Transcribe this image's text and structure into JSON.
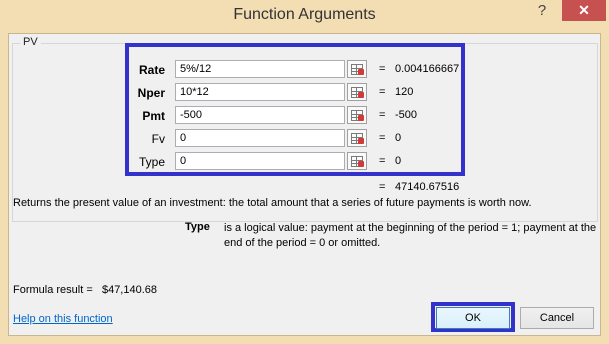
{
  "window": {
    "title": "Function Arguments",
    "help_glyph": "?",
    "close_glyph": "✕"
  },
  "function": {
    "name": "PV",
    "arguments": [
      {
        "label": "Rate",
        "value": "5%/12",
        "result": "0.004166667",
        "bold": true
      },
      {
        "label": "Nper",
        "value": "10*12",
        "result": "120",
        "bold": true
      },
      {
        "label": "Pmt",
        "value": "-500",
        "result": "-500",
        "bold": true
      },
      {
        "label": "Fv",
        "value": "0",
        "result": "0",
        "bold": false
      },
      {
        "label": "Type",
        "value": "0",
        "result": "0",
        "bold": false
      }
    ],
    "equals": "=",
    "total_result": "47140.67516",
    "description": "Returns the present value of an investment: the total amount that a series of future payments is worth now.",
    "arg_desc_name": "Type",
    "arg_desc_text": "is a logical value: payment at the beginning of the period = 1; payment at the end of the period = 0 or omitted."
  },
  "footer": {
    "formula_result_label": "Formula result =",
    "formula_result_value": "$47,140.68",
    "help_link": "Help on this function",
    "ok_label": "OK",
    "cancel_label": "Cancel"
  },
  "colors": {
    "frame": "#f3ddb3",
    "highlight": "#3333cc",
    "close": "#c75050",
    "link": "#0066cc"
  },
  "icons": {
    "ref_button": "collapse-dialog-icon"
  }
}
